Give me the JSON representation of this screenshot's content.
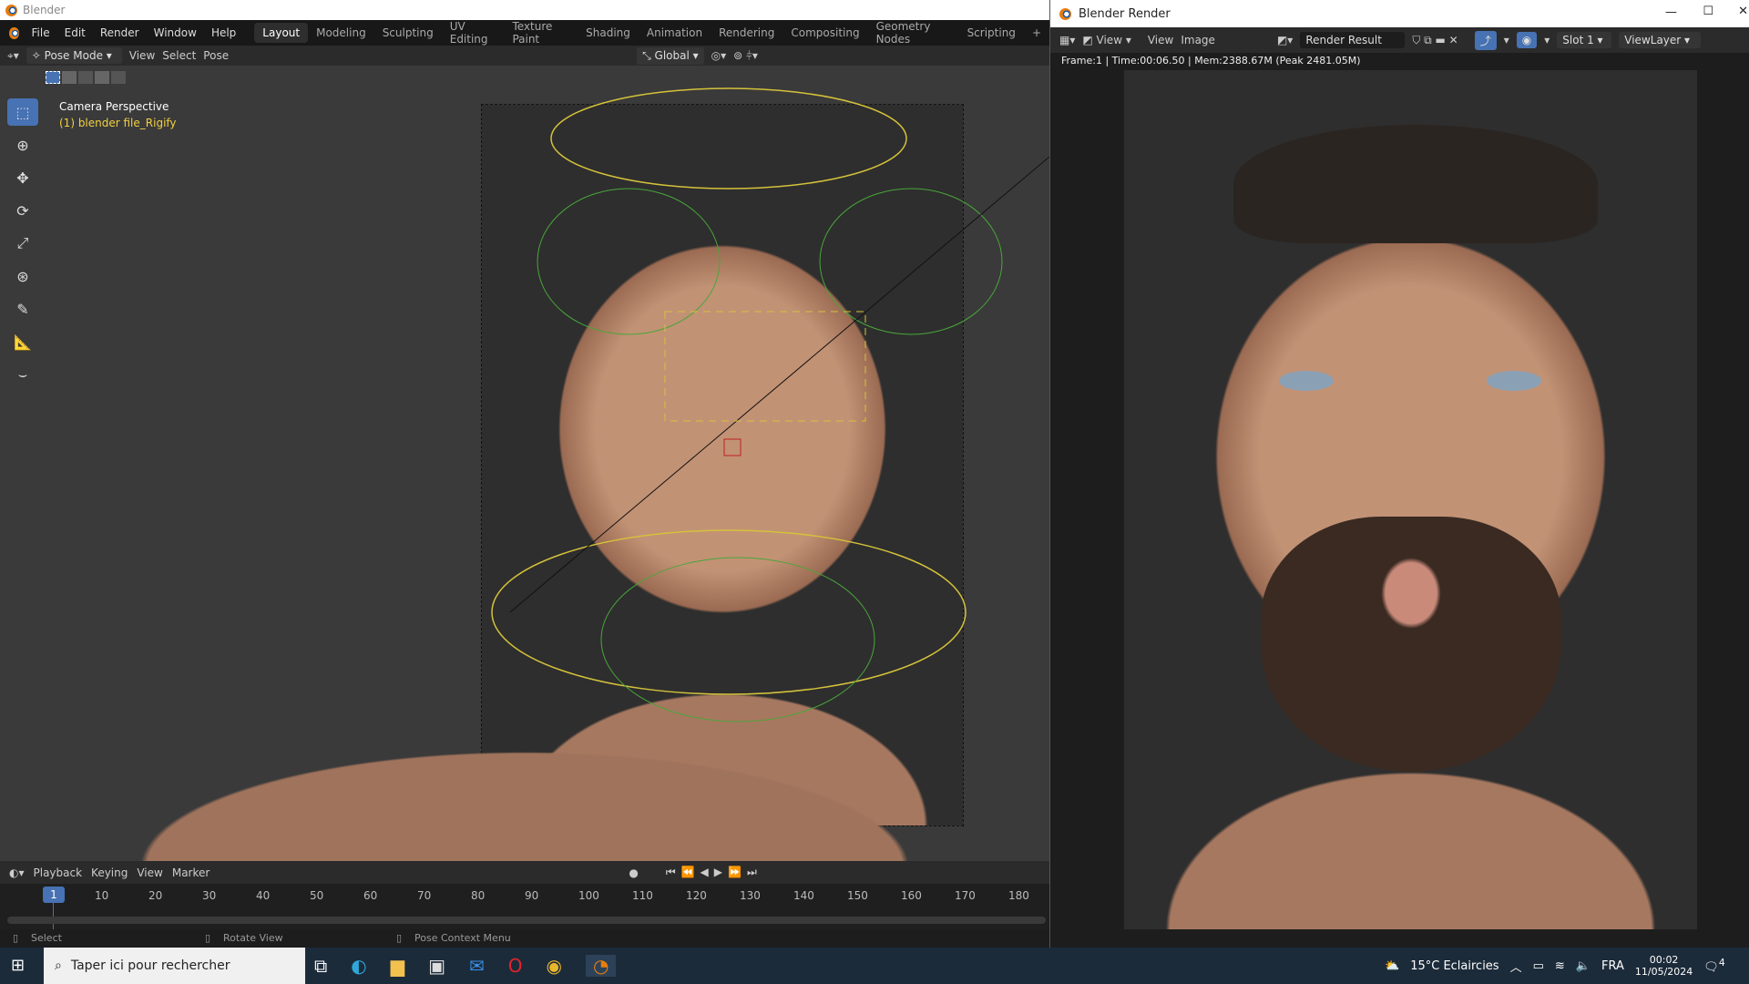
{
  "app": {
    "title": "Blender"
  },
  "menu": [
    "File",
    "Edit",
    "Render",
    "Window",
    "Help"
  ],
  "workspaces": [
    "Layout",
    "Modeling",
    "Sculpting",
    "UV Editing",
    "Texture Paint",
    "Shading",
    "Animation",
    "Rendering",
    "Compositing",
    "Geometry Nodes",
    "Scripting",
    "+"
  ],
  "header": {
    "mode": "Pose Mode",
    "menus": [
      "View",
      "Select",
      "Pose"
    ],
    "orientation": "Global"
  },
  "viewport": {
    "title": "Camera Perspective",
    "object": "(1) blender file_Rigify"
  },
  "timeline": {
    "menus": [
      "Playback",
      "Keying",
      "View",
      "Marker"
    ],
    "current_frame": "1",
    "ticks": [
      "10",
      "20",
      "30",
      "40",
      "50",
      "60",
      "70",
      "80",
      "90",
      "100",
      "110",
      "120",
      "130",
      "140",
      "150",
      "160",
      "170",
      "180"
    ]
  },
  "status": {
    "select": "Select",
    "rotate": "Rotate View",
    "context": "Pose Context Menu"
  },
  "render": {
    "title": "Blender Render",
    "view1": "View",
    "view2": "View",
    "image": "Image",
    "result": "Render Result",
    "slot": "Slot 1",
    "layer": "ViewLayer",
    "info": "Frame:1 | Time:00:06.50 | Mem:2388.67M (Peak 2481.05M)"
  },
  "taskbar": {
    "search_placeholder": "Taper ici pour rechercher",
    "weather": "15°C  Eclaircies",
    "lang": "FRA",
    "time": "00:02",
    "date": "11/05/2024",
    "notifications": "4"
  }
}
